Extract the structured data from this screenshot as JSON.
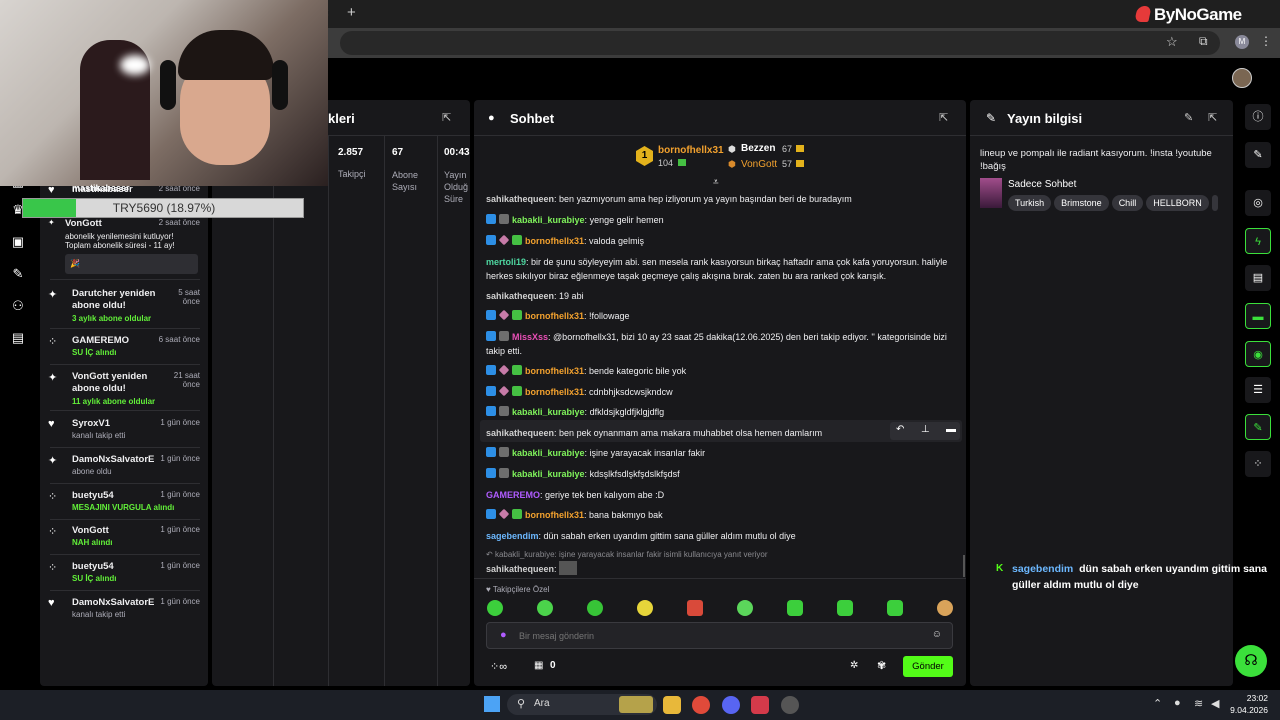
{
  "browser": {
    "new_tab_symbol": "+",
    "close_tab_symbol": "×",
    "profile_initial": "M"
  },
  "brand": {
    "name": "ByNoGame"
  },
  "overlay": {
    "username": "mastikabaser",
    "goal_text": "TRY5690 (18.97%)",
    "goal_progress": 0.1897
  },
  "left_nav_icons": [
    "chart-icon",
    "trophy-icon",
    "film-icon",
    "wrench-icon",
    "users-icon",
    "widget-icon"
  ],
  "activity": {
    "items": [
      {
        "name": "mastikabaser",
        "time": "2 saat önce",
        "sub": ""
      },
      {
        "name": "VonGott",
        "time": "2 saat önce",
        "sub": "abonelik yenilemesini kutluyor!",
        "sub2": "Toplam abonelik süresi - 11 ay!"
      },
      {
        "name": "Darutcher yeniden abone oldu!",
        "time": "5 saat önce",
        "sub": "3 aylık abone oldular"
      },
      {
        "name": "GAMEREMO",
        "time": "6 saat önce",
        "sub": "SU İÇ alındı"
      },
      {
        "name": "VonGott yeniden abone oldu!",
        "time": "21 saat önce",
        "sub": "11 aylık abone oldular"
      },
      {
        "name": "SyroxV1",
        "time": "1 gün önce",
        "sub": "kanalı takip etti"
      },
      {
        "name": "DamoNxSalvatorE",
        "time": "1 gün önce",
        "sub": "abone oldu"
      },
      {
        "name": "buetyu54",
        "time": "1 gün önce",
        "sub": "MESAJINI VURGULA alındı"
      },
      {
        "name": "VonGott",
        "time": "1 gün önce",
        "sub": "NAH alındı"
      },
      {
        "name": "buetyu54",
        "time": "1 gün önce",
        "sub": "SU İÇ alındı"
      },
      {
        "name": "DamoNxSalvatorE",
        "time": "1 gün önce",
        "sub": "kanalı takip etti"
      }
    ]
  },
  "stats": {
    "title_fragment": "kleri",
    "cols": [
      {
        "value": "2.857",
        "label": "Takipçi"
      },
      {
        "value": "67",
        "label": "Abone Sayısı"
      },
      {
        "value": "00:43",
        "label": "Yayın Olduğ Süre"
      }
    ]
  },
  "chat": {
    "title": "Sohbet",
    "leaderboard": {
      "first": {
        "name": "bornofhellx31",
        "score": "104"
      },
      "second": {
        "name": "Bezzen",
        "score": "67"
      },
      "third": {
        "name": "VonGott",
        "score": "57"
      }
    },
    "messages": [
      {
        "user": "sahikathequeen",
        "text": "ben yazmıyorum ama hep izliyorum ya yayın başından beri de buradayım",
        "color": "grey"
      },
      {
        "user": "kabakli_kurabiye",
        "text": "yenge gelir hemen",
        "color": "green"
      },
      {
        "user": "bornofhellx31",
        "text": "valoda gelmiş",
        "color": "orange"
      },
      {
        "user": "mertoli19",
        "text": "bir de şunu söyleyeyim abi. sen mesela rank kasıyorsun birkaç haftadır ama çok kafa yoruyorsun. haliyle herkes sıkılıyor biraz eğlenmeye taşak geçmeye çalış akışına bırak. zaten bu ara ranked çok karışık.",
        "color": "green"
      },
      {
        "user": "sahikathequeen",
        "text": "19 abi",
        "color": "grey"
      },
      {
        "user": "bornofhellx31",
        "text": "!followage",
        "color": "orange"
      },
      {
        "user": "MissXss",
        "text": "@bornofhellx31, bizi 10 ay 23 saat 25 dakika(12.06.2025) den beri takip ediyor. '' kategorisinde bizi takip etti.",
        "color": "pink"
      },
      {
        "user": "bornofhellx31",
        "text": "bende kategoric bile yok",
        "color": "orange"
      },
      {
        "user": "bornofhellx31",
        "text": "cdnbhjksdcwsjkndcw",
        "color": "orange"
      },
      {
        "user": "kabakli_kurabiye",
        "text": "dfkldsjkgldfjklgjdflg",
        "color": "green"
      },
      {
        "user": "sahikathequeen",
        "text": "ben pek oynanmam ama makara muhabbet olsa hemen damlarım",
        "color": "grey"
      },
      {
        "user": "kabakli_kurabiye",
        "text": "işine yarayacak insanlar fakir",
        "color": "green"
      },
      {
        "user": "kabakli_kurabiye",
        "text": "kdsşlkfsdlşkfşdslkfşdsf",
        "color": "green"
      },
      {
        "user": "GAMEREMO",
        "text": "geriye tek ben kalıyom abe :D",
        "color": "purple"
      },
      {
        "user": "bornofhellx31",
        "text": "bana bakmıyo bak",
        "color": "orange"
      },
      {
        "user": "sagebendim",
        "text": "dün sabah erken uyandım gittim sana güller aldım mutlu ol diye",
        "color": "blue"
      }
    ],
    "reply_hint": "kabakli_kurabiye: işine yarayacak insanlar fakir isimli kullanıcıya yanıt veriyor",
    "last_user": "sahikathequeen",
    "followers_only": "Takipçilere Özel",
    "input_placeholder": "Bir mesaj gönderin",
    "points": "0",
    "send_label": "Gönder"
  },
  "info": {
    "title": "Yayın bilgisi",
    "description": "lineup ve pompalı ile radiant kasıyorum. !insta !youtube !bağış",
    "category": "Sadece Sohbet",
    "tags": [
      "Turkish",
      "Brimstone",
      "Chill",
      "HELLBORN"
    ]
  },
  "overlay_chat": {
    "user": "sagebendim",
    "text": "dün sabah erken uyandım gittim sana güller aldım mutlu ol diye"
  },
  "taskbar": {
    "search_label": "Ara",
    "time": "23:02",
    "date": "9.04.2026"
  },
  "colors": {
    "accent_green": "#53fc18",
    "panel": "#18181b"
  }
}
